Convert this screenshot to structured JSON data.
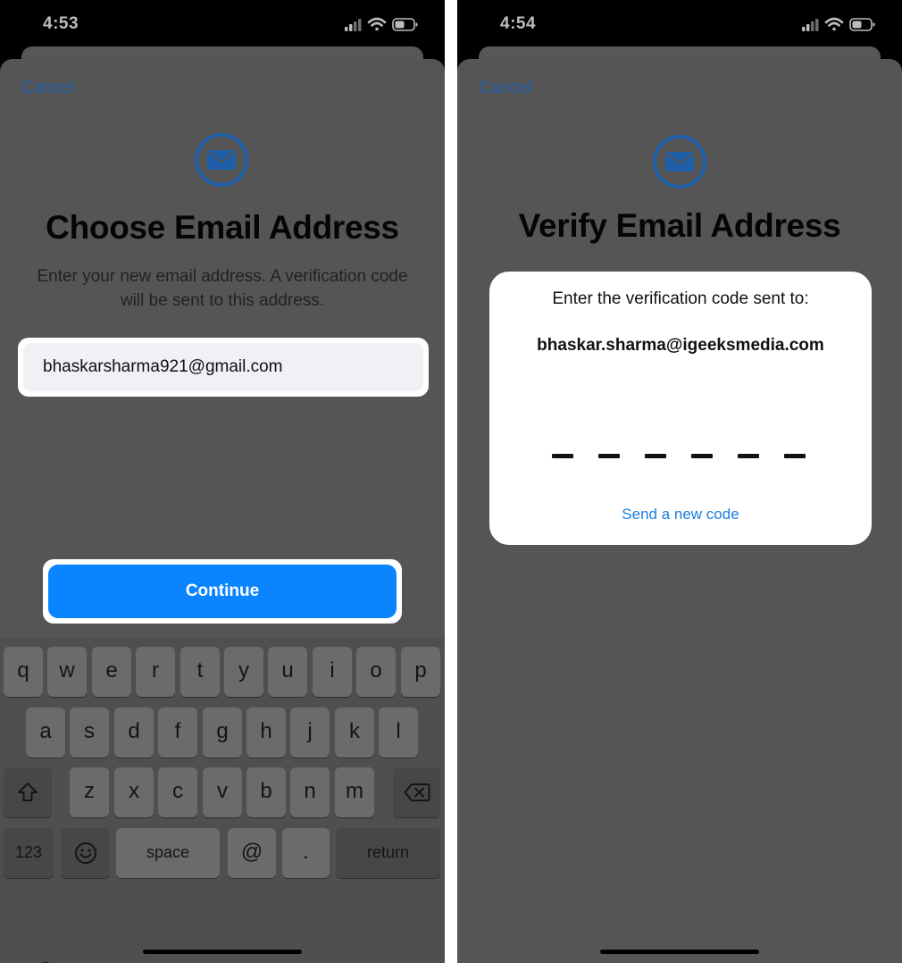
{
  "left": {
    "status": {
      "time": "4:53"
    },
    "cancel_label": "Cancel",
    "title": "Choose Email Address",
    "subtitle": "Enter your new email address. A verification code will be sent to this address.",
    "email_value": "bhaskarsharma921@gmail.com",
    "continue_label": "Continue",
    "keyboard": {
      "row1": [
        "q",
        "w",
        "e",
        "r",
        "t",
        "y",
        "u",
        "i",
        "o",
        "p"
      ],
      "row2": [
        "a",
        "s",
        "d",
        "f",
        "g",
        "h",
        "j",
        "k",
        "l"
      ],
      "row3": [
        "z",
        "x",
        "c",
        "v",
        "b",
        "n",
        "m"
      ],
      "numbers_label": "123",
      "space_label": "space",
      "at_label": "@",
      "dot_label": ".",
      "return_label": "return",
      "shift_icon": "shift-icon",
      "delete_icon": "delete-icon",
      "emoji_icon": "emoji-icon",
      "globe_icon": "globe-icon"
    }
  },
  "right": {
    "status": {
      "time": "4:54"
    },
    "cancel_label": "Cancel",
    "title": "Verify Email Address",
    "verify_prompt": "Enter the verification code sent to:",
    "verify_email": "bhaskar.sharma@igeeksmedia.com",
    "code_length": 6,
    "send_new_code_label": "Send a new code"
  },
  "colors": {
    "accent": "#0a84ff",
    "link_dim": "#1f5ea8",
    "link_bright": "#1a7fe0",
    "dim_background": "#555555"
  }
}
